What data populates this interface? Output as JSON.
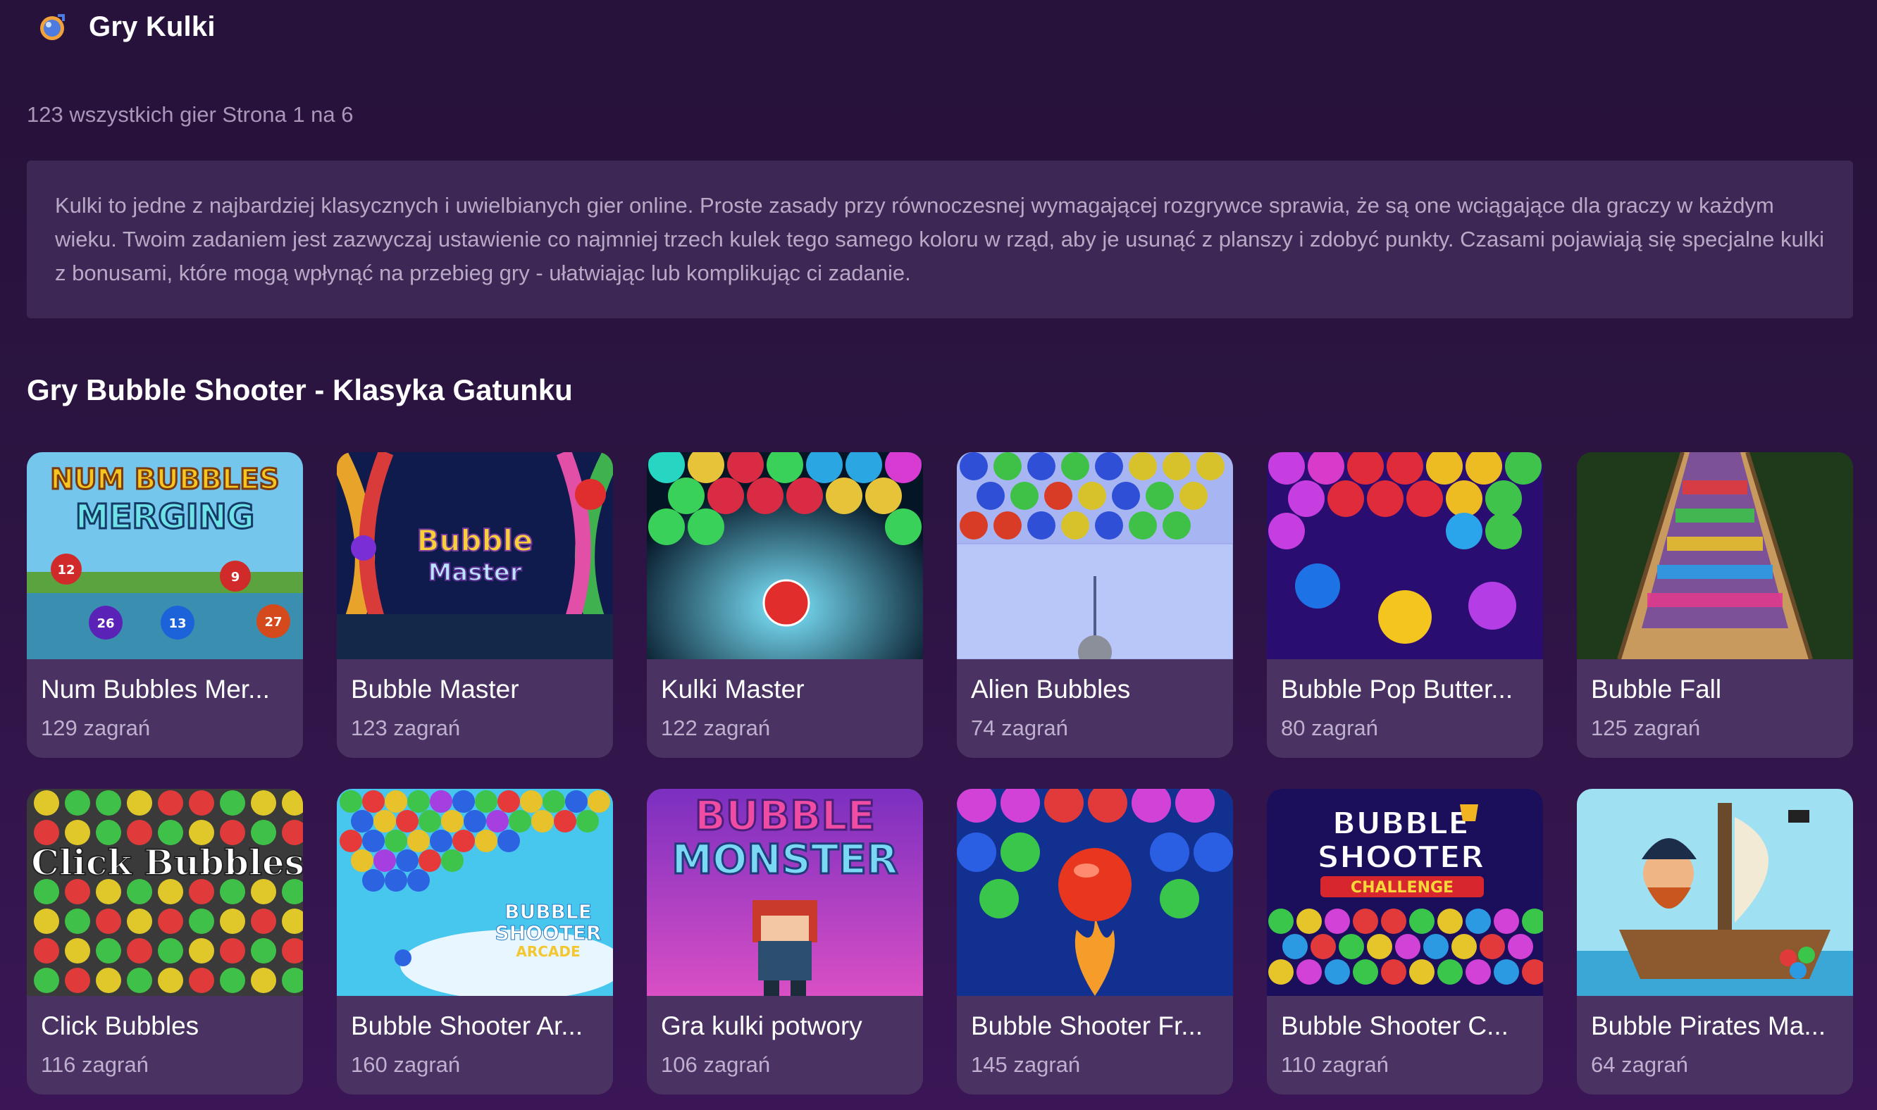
{
  "header": {
    "title": "Gry Kulki",
    "icon": "bubble-icon"
  },
  "subinfo": "123 wszystkich gier Strona 1 na 6",
  "description": "Kulki to jedne z najbardziej klasycznych i uwielbianych gier online. Proste zasady przy równoczesnej wymagającej rozgrywce sprawia, że są one wciągające dla graczy w każdym wieku. Twoim zadaniem jest zazwyczaj ustawienie co najmniej trzech kulek tego samego koloru w rząd, aby je usunąć z planszy i zdobyć punkty. Czasami pojawiają się specjalne kulki z bonusami, które mogą wpłynąć na przebieg gry - ułatwiając lub komplikując ci zadanie.",
  "section_title": "Gry Bubble Shooter - Klasyka Gatunku",
  "games": [
    {
      "title": "Num Bubbles Mer...",
      "plays": "129 zagrań",
      "thumb_text": "NUM BUBBLES MERGING",
      "bg": "#6cc3ea"
    },
    {
      "title": "Bubble Master",
      "plays": "123 zagrań",
      "thumb_text": "Bubble Master",
      "bg": "#0e1a4a"
    },
    {
      "title": "Kulki Master",
      "plays": "122 zagrań",
      "thumb_text": "",
      "bg": "#07203a"
    },
    {
      "title": "Alien Bubbles",
      "plays": "74 zagrań",
      "thumb_text": "",
      "bg": "#a9b8f4"
    },
    {
      "title": "Bubble Pop Butter...",
      "plays": "80 zagrań",
      "thumb_text": "",
      "bg": "#2b0c73"
    },
    {
      "title": "Bubble Fall",
      "plays": "125 zagrań",
      "thumb_text": "",
      "bg": "#1f3c1a"
    },
    {
      "title": "Click Bubbles",
      "plays": "116 zagrań",
      "thumb_text": "Click Bubbles",
      "bg": "#3f3f3f"
    },
    {
      "title": "Bubble Shooter Ar...",
      "plays": "160 zagrań",
      "thumb_text": "BUBBLE SHOOTER ARCADE",
      "bg": "#45c7ee"
    },
    {
      "title": "Gra kulki potwory",
      "plays": "106 zagrań",
      "thumb_text": "BUBBLE MONSTER",
      "bg": "#b23ec2"
    },
    {
      "title": "Bubble Shooter Fr...",
      "plays": "145 zagrań",
      "thumb_text": "",
      "bg": "#12318f"
    },
    {
      "title": "Bubble Shooter C...",
      "plays": "110 zagrań",
      "thumb_text": "BUBBLE SHOOTER CHALLENGE",
      "bg": "#1a0f5a"
    },
    {
      "title": "Bubble Pirates Ma...",
      "plays": "64 zagrań",
      "thumb_text": "",
      "bg": "#9fe2f3"
    }
  ]
}
